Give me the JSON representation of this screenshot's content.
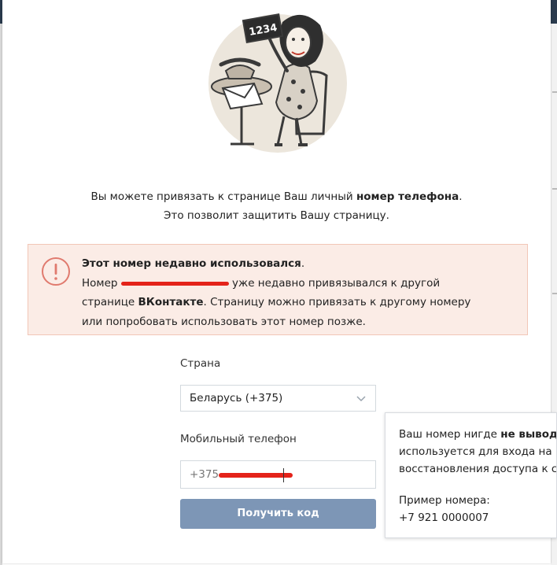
{
  "intro": {
    "line1_prefix": "Вы можете привязать к странице Ваш личный ",
    "line1_bold": "номер телефона",
    "line1_suffix": ".",
    "line2": "Это позволит защитить Вашу страницу."
  },
  "illustration": {
    "sign_text": "1234"
  },
  "warning": {
    "title": "Этот номер недавно использовался",
    "title_suffix": ".",
    "line2_prefix": "Номер ",
    "line2_suffix": " уже недавно привязывался к другой",
    "line3_prefix": "странице ",
    "line3_bold": "ВКонтакте",
    "line3_suffix": ". Страницу можно привязать к другому номеру",
    "line4": "или попробовать использовать этот номер позже."
  },
  "form": {
    "country_label": "Страна",
    "country_value": "Беларусь (+375)",
    "phone_label": "Мобильный телефон",
    "phone_value": "+375",
    "submit_label": "Получить код"
  },
  "tooltip": {
    "line1_prefix": "Ваш номер нигде ",
    "line1_bold": "не вывод",
    "line2": "используется для входа на",
    "line3": "восстановления доступа к с",
    "example_label": "Пример номера:",
    "example_value": "+7 921 0000007"
  },
  "colors": {
    "warning_bg": "#fbece6",
    "warning_icon": "#e07a6e",
    "button_bg": "#7d96b6",
    "redaction": "#e4231a"
  }
}
